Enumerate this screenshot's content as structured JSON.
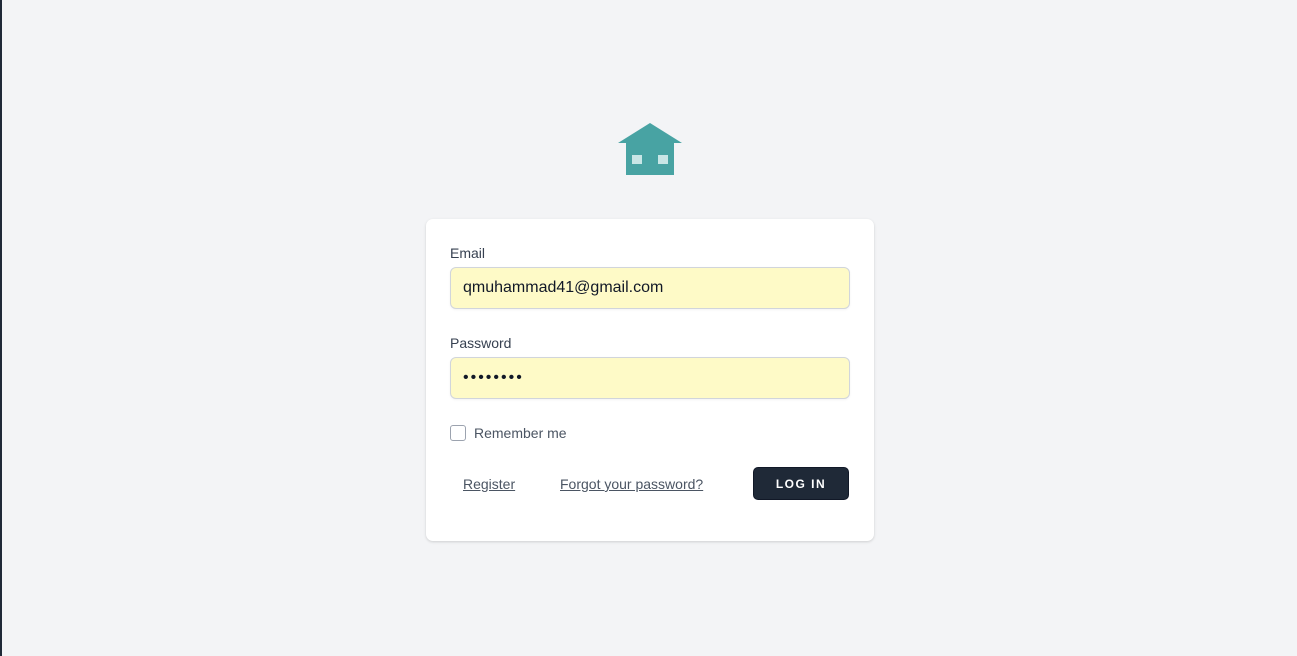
{
  "logo": {
    "icon": "house-icon",
    "color": "#48a3a3"
  },
  "form": {
    "email_label": "Email",
    "email_value": "qmuhammad41@gmail.com",
    "password_label": "Password",
    "password_value": "••••••••",
    "remember_label": "Remember me",
    "remember_checked": false,
    "register_link": "Register",
    "forgot_link": "Forgot your password?",
    "login_button": "LOG IN"
  },
  "colors": {
    "page_bg": "#f3f4f6",
    "input_autofill_bg": "#fefac7",
    "button_bg": "#1f2937"
  }
}
